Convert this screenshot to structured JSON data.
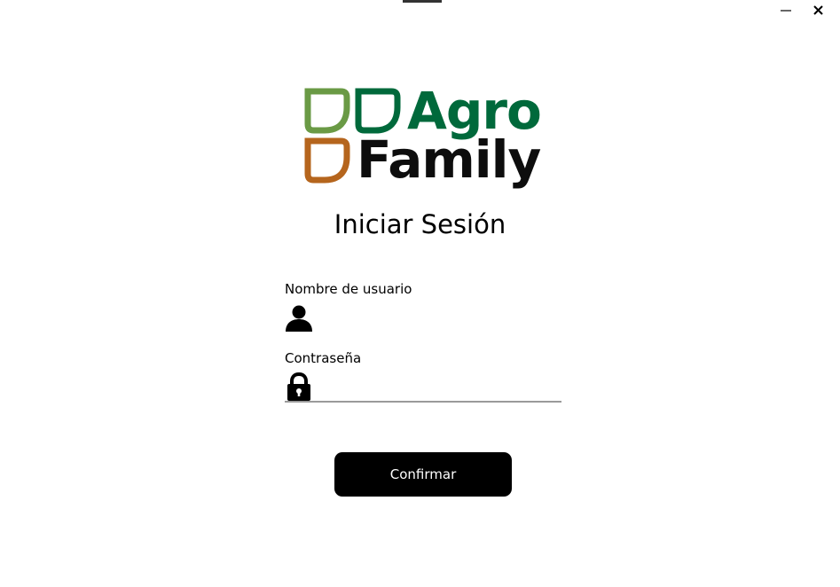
{
  "window": {
    "minimize_icon": "minimize-icon",
    "close_icon": "close-icon"
  },
  "logo": {
    "word_1": "Agro",
    "word_2": "Family",
    "colors": {
      "light_green": "#6a9a45",
      "dark_green": "#00693b",
      "orange": "#b5651d",
      "black": "#0d0d0d"
    }
  },
  "login": {
    "title": "Iniciar Sesión",
    "username_label": "Nombre de usuario",
    "username_value": "",
    "username_icon": "user-icon",
    "password_label": "Contraseña",
    "password_value": "",
    "password_icon": "lock-icon",
    "confirm_label": "Confirmar"
  }
}
